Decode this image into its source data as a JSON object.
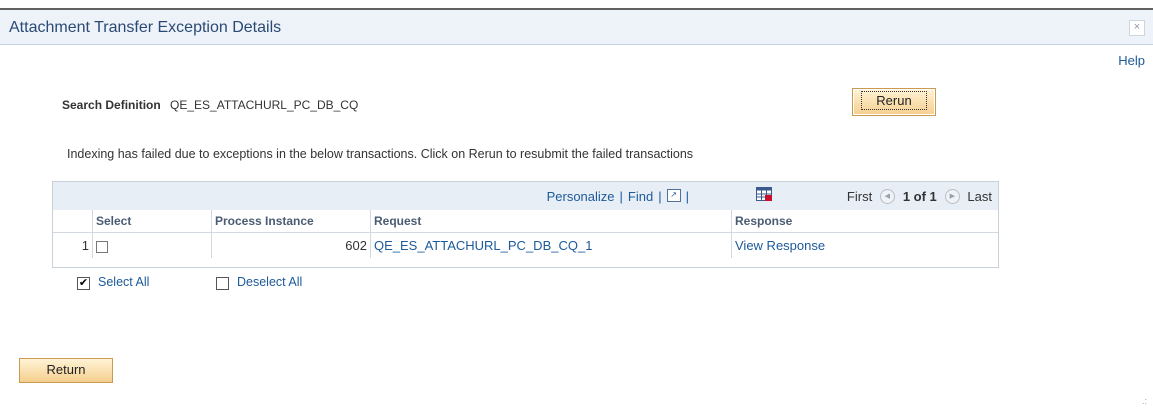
{
  "window": {
    "title": "Attachment Transfer Exception Details",
    "close_label": "×",
    "help_label": "Help"
  },
  "search": {
    "label": "Search Definition",
    "value": "QE_ES_ATTACHURL_PC_DB_CQ"
  },
  "buttons": {
    "rerun": "Rerun",
    "return": "Return"
  },
  "info_text": "Indexing has failed due to exceptions in the below transactions. Click on Rerun to resubmit the failed transactions",
  "grid": {
    "nav": {
      "personalize": "Personalize",
      "find": "Find",
      "separator": "|",
      "first": "First",
      "count": "1 of 1",
      "last": "Last"
    },
    "columns": [
      "Select",
      "Process Instance",
      "Request",
      "Response"
    ],
    "rows": [
      {
        "row_num": "1",
        "process_instance": "602",
        "request": "QE_ES_ATTACHURL_PC_DB_CQ_1",
        "response": "View Response"
      }
    ]
  },
  "select_all": {
    "label": "Select All",
    "checked": true
  },
  "deselect_all": {
    "label": "Deselect All",
    "checked": false
  },
  "colors": {
    "link": "#1c5a9a",
    "title": "#2a4a73",
    "button": "#f5cf8e",
    "grid_header": "#e8eef6"
  }
}
